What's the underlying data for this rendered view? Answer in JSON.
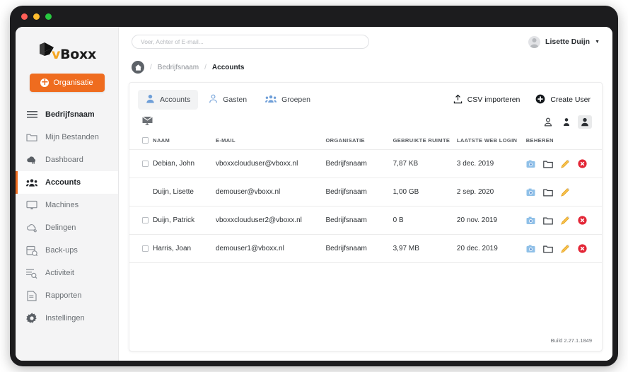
{
  "window": {
    "traffic_lights": [
      "close",
      "minimize",
      "maximize"
    ]
  },
  "sidebar": {
    "logo": {
      "text_v": "v",
      "text_rest": "Boxx",
      "mark": "cube-arrow-logo"
    },
    "org_button": {
      "label": "Organisatie",
      "icon": "plus-circle-icon",
      "color": "#ef6c1f"
    },
    "items": [
      {
        "label": "Bedrijfsnaam",
        "icon": "menu-lines-icon",
        "state": "bold"
      },
      {
        "label": "Mijn Bestanden",
        "icon": "folder-icon",
        "state": "normal"
      },
      {
        "label": "Dashboard",
        "icon": "cloud-chart-icon",
        "state": "normal"
      },
      {
        "label": "Accounts",
        "icon": "users-group-icon",
        "state": "active"
      },
      {
        "label": "Machines",
        "icon": "monitor-icon",
        "state": "normal"
      },
      {
        "label": "Delingen",
        "icon": "cloud-share-icon",
        "state": "normal"
      },
      {
        "label": "Back-ups",
        "icon": "backup-icon",
        "state": "normal"
      },
      {
        "label": "Activiteit",
        "icon": "activity-search-icon",
        "state": "normal"
      },
      {
        "label": "Rapporten",
        "icon": "document-icon",
        "state": "normal"
      },
      {
        "label": "Instellingen",
        "icon": "gear-icon",
        "state": "normal"
      }
    ]
  },
  "topbar": {
    "search": {
      "placeholder": "Voer, Achter of E-mail...",
      "value": ""
    },
    "user": {
      "name": "Lisette Duijn",
      "caret": "▼",
      "avatar": "user-avatar"
    }
  },
  "breadcrumb": {
    "home_icon": "home-icon",
    "sep": "/",
    "items": [
      {
        "label": "Bedrijfsnaam",
        "current": false
      },
      {
        "label": "Accounts",
        "current": true
      }
    ]
  },
  "panel": {
    "tabs": [
      {
        "label": "Accounts",
        "icon": "user-filled-icon",
        "active": true
      },
      {
        "label": "Gasten",
        "icon": "user-outline-icon",
        "active": false
      },
      {
        "label": "Groepen",
        "icon": "users-group-icon",
        "active": false
      }
    ],
    "actions": [
      {
        "label": "CSV importeren",
        "icon": "upload-icon"
      },
      {
        "label": "Create User",
        "icon": "plus-circle-filled-icon"
      }
    ],
    "subbar": {
      "left_icon": "mail-envelope-icon",
      "filters": [
        {
          "icon": "user-outline-icon",
          "active": false
        },
        {
          "icon": "user-small-filled-icon",
          "active": false
        },
        {
          "icon": "user-filled-icon",
          "active": true
        }
      ]
    },
    "table": {
      "columns": [
        "",
        "NAAM",
        "E-MAIL",
        "ORGANISATIE",
        "GEBRUIKTE RUIMTE",
        "LAATSTE WEB LOGIN",
        "BEHEREN"
      ],
      "rows": [
        {
          "checkbox": true,
          "naam": "Debian, John",
          "email": "vboxxclouduser@vboxx.nl",
          "organisatie": "Bedrijfsnaam",
          "ruimte": "7,87 KB",
          "login": "3 dec. 2019",
          "acties": [
            "camera-icon",
            "folder-icon",
            "pencil-icon",
            "delete-circle-icon"
          ]
        },
        {
          "checkbox": false,
          "naam": "Duijn, Lisette",
          "email": "demouser@vboxx.nl",
          "organisatie": "Bedrijfsnaam",
          "ruimte": "1,00 GB",
          "login": "2 sep. 2020",
          "acties": [
            "camera-icon",
            "folder-icon",
            "pencil-icon"
          ]
        },
        {
          "checkbox": true,
          "naam": "Duijn, Patrick",
          "email": "vboxxclouduser2@vboxx.nl",
          "organisatie": "Bedrijfsnaam",
          "ruimte": "0 B",
          "login": "20 nov. 2019",
          "acties": [
            "camera-icon",
            "folder-icon",
            "pencil-icon",
            "delete-circle-icon"
          ]
        },
        {
          "checkbox": true,
          "naam": "Harris, Joan",
          "email": "demouser1@vboxx.nl",
          "organisatie": "Bedrijfsnaam",
          "ruimte": "3,97 MB",
          "login": "20 dec. 2019",
          "acties": [
            "camera-icon",
            "folder-icon",
            "pencil-icon",
            "delete-circle-icon"
          ]
        }
      ]
    },
    "build": "Build 2.27.1.1849"
  },
  "colors": {
    "accent": "#ef6c1f",
    "tab_icon": "#6f9fd8",
    "delete": "#e32636",
    "pencil": "#f0a81e",
    "camera": "#8fc0e8"
  }
}
